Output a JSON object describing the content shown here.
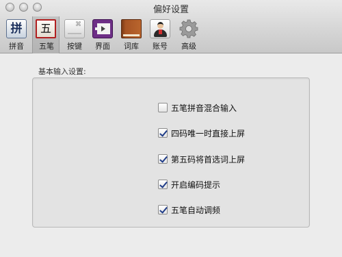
{
  "window": {
    "title": "偏好设置"
  },
  "toolbar": {
    "items": [
      {
        "label": "拼音",
        "glyph": "拼",
        "icon": "pinyin-icon"
      },
      {
        "label": "五笔",
        "glyph": "五",
        "icon": "wubi-icon",
        "selected": true
      },
      {
        "label": "按键",
        "glyph": "⌘",
        "icon": "keyboard-icon"
      },
      {
        "label": "界面",
        "icon": "interface-icon"
      },
      {
        "label": "词库",
        "icon": "dictionary-icon"
      },
      {
        "label": "账号",
        "icon": "account-icon"
      },
      {
        "label": "高级",
        "icon": "gear-icon"
      }
    ]
  },
  "settings": {
    "group_label": "基本输入设置:",
    "options": [
      {
        "label": "五笔拼音混合输入",
        "checked": false
      },
      {
        "label": "四码唯一时直接上屏",
        "checked": true
      },
      {
        "label": "第五码将首选词上屏",
        "checked": true
      },
      {
        "label": "开启编码提示",
        "checked": true
      },
      {
        "label": "五笔自动调频",
        "checked": true
      }
    ]
  },
  "colors": {
    "selection_border": "#b11f1f",
    "check_mark": "#1f3c88",
    "window_bg": "#ececec"
  }
}
